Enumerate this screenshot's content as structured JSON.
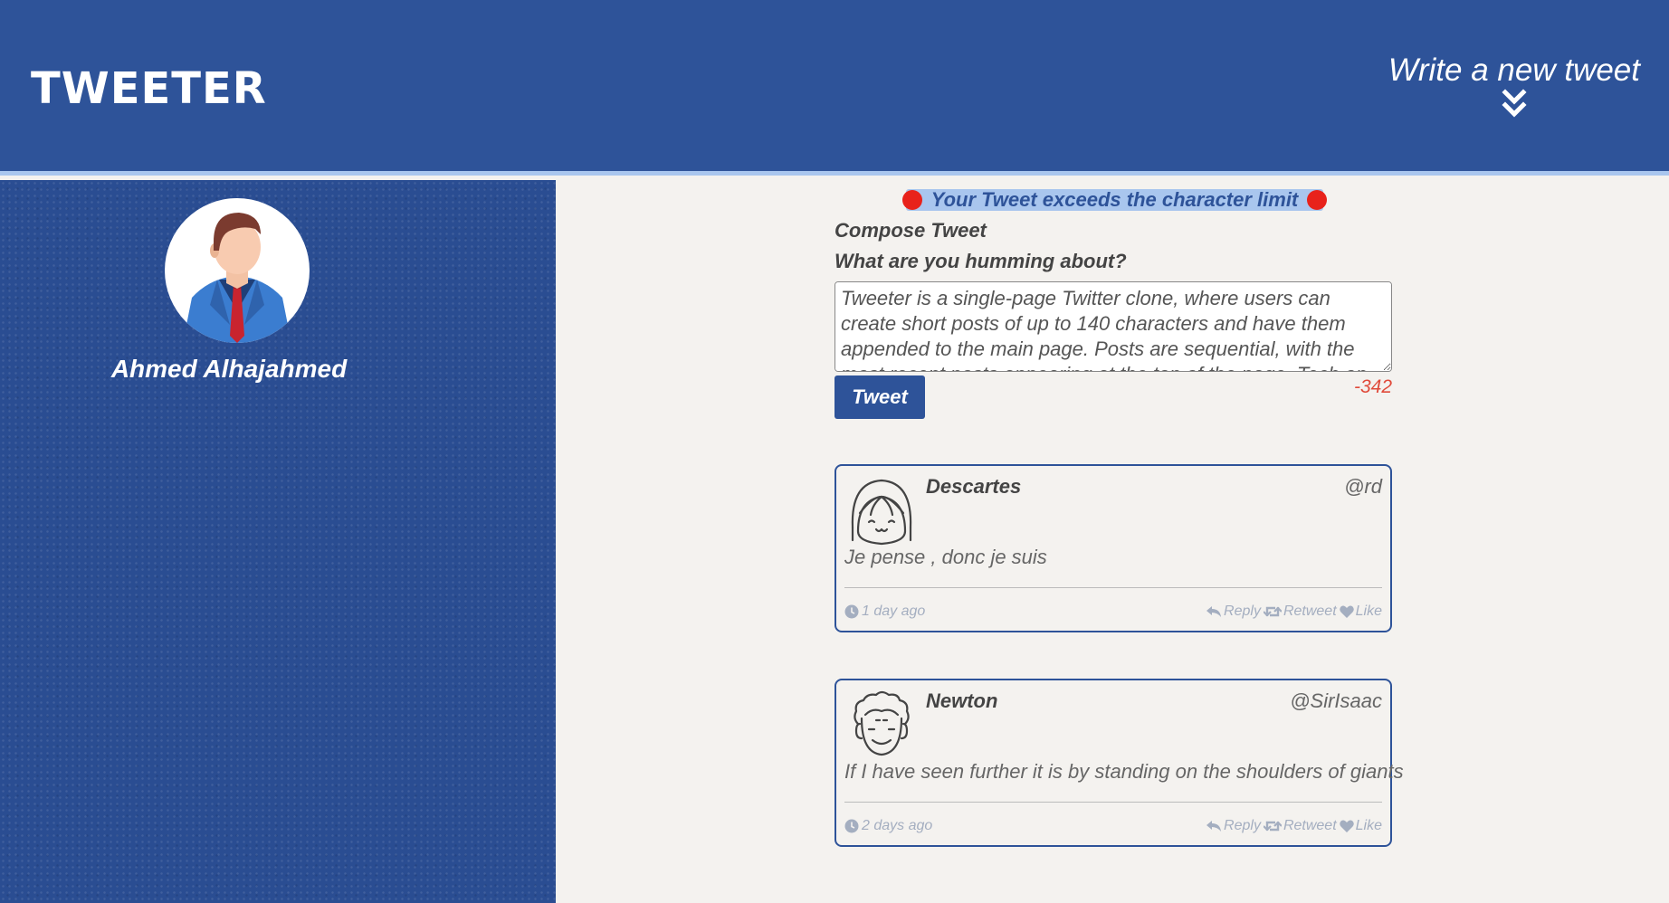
{
  "nav": {
    "brand": "TWEETER",
    "compose_toggle": "Write a new tweet"
  },
  "profile": {
    "name": "Ahmed Alhajahmed"
  },
  "compose": {
    "error": "Your Tweet exceeds the character limit",
    "title": "Compose Tweet",
    "prompt": "What are you humming about?",
    "text": "Tweeter is a single-page Twitter clone, where users can create short posts of up to 140 characters and have them appended to the main page. Posts are sequential, with the most recent posts appearing at the top of the page. Tech on Tweeter",
    "button": "Tweet",
    "counter": "-342"
  },
  "colors": {
    "brand_blue": "#2e5399",
    "banner_light": "#a9c6ee",
    "error_red": "#e8221b",
    "counter_red": "#e04a3a",
    "background": "#f4f2ef"
  },
  "tweets": [
    {
      "name": "Descartes",
      "handle": "@rd",
      "text": "Je pense , donc je suis",
      "time": "1 day ago",
      "avatar_icon": "girl-face-icon",
      "actions": {
        "reply": "Reply",
        "retweet": "Retweet",
        "like": "Like"
      }
    },
    {
      "name": "Newton",
      "handle": "@SirIsaac",
      "text": "If I have seen further it is by standing on the shoulders of giants",
      "time": "2 days ago",
      "avatar_icon": "curly-hair-face-icon",
      "actions": {
        "reply": "Reply",
        "retweet": "Retweet",
        "like": "Like"
      }
    }
  ]
}
